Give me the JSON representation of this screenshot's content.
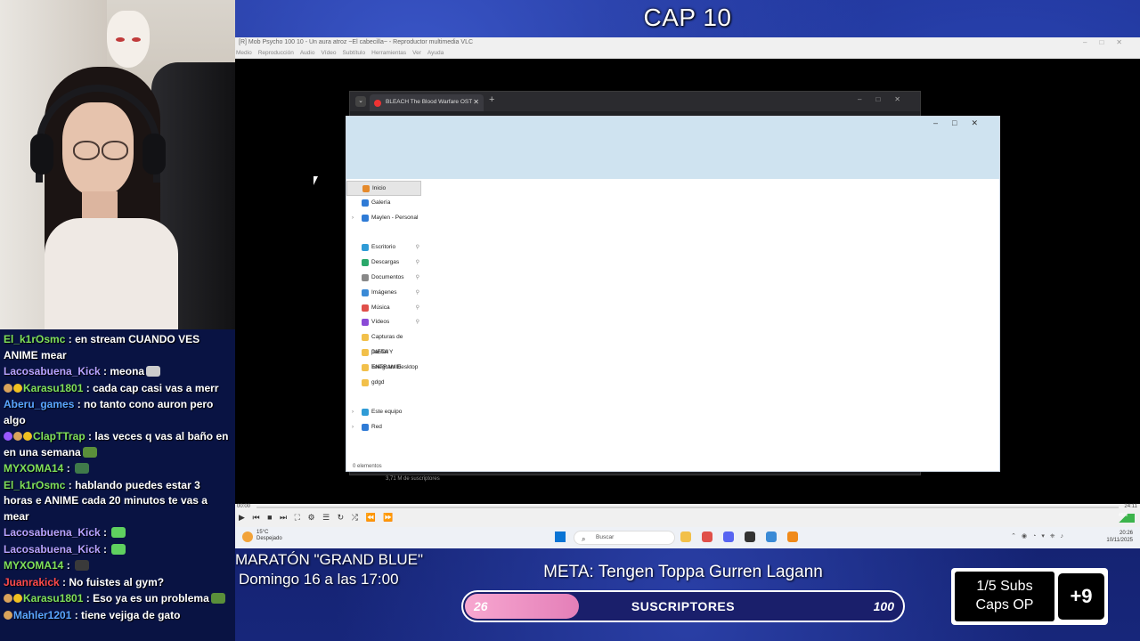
{
  "stream": {
    "episode_title": "CAP 10"
  },
  "chat": {
    "messages": [
      {
        "user": "El_k1rOsmc",
        "color": "#7fe05a",
        "badges": [],
        "text": "en stream CUANDO VES ANIME mear",
        "emote": null
      },
      {
        "user": "Lacosabuena_Kick",
        "color": "#b9a3ff",
        "badges": [],
        "text": "meona",
        "emote": "#cccccc"
      },
      {
        "user": "Karasu1801",
        "color": "#7fe05a",
        "badges": [
          "#d9a35b",
          "#f0c020"
        ],
        "text": "cada cap casi vas a merr",
        "emote": null
      },
      {
        "user": "Aberu_games",
        "color": "#5aa6ff",
        "badges": [],
        "text": "no tanto cono auron pero algo",
        "emote": null
      },
      {
        "user": "ClapTTrap",
        "color": "#7fe05a",
        "badges": [
          "#9b59ff",
          "#d9a35b",
          "#f0c020"
        ],
        "text": "las veces q vas al baño en en una semana",
        "emote": "#5a8f3a"
      },
      {
        "user": "MYXOMA14",
        "color": "#7fe05a",
        "badges": [],
        "text": "",
        "emote": "#3f7a4a"
      },
      {
        "user": "El_k1rOsmc",
        "color": "#7fe05a",
        "badges": [],
        "text": "hablando puedes estar 3 horas e ANIME cada 20 minutos te vas a mear",
        "emote": null
      },
      {
        "user": "Lacosabuena_Kick",
        "color": "#b9a3ff",
        "badges": [],
        "text": "",
        "emote": "#5fd05f"
      },
      {
        "user": "Lacosabuena_Kick",
        "color": "#b9a3ff",
        "badges": [],
        "text": "",
        "emote": "#5fd05f"
      },
      {
        "user": "MYXOMA14",
        "color": "#7fe05a",
        "badges": [],
        "text": "",
        "emote": "#3a3a3a"
      },
      {
        "user": "Juanrakick",
        "color": "#ff4a4a",
        "badges": [],
        "text": "No fuistes al gym?",
        "emote": null
      },
      {
        "user": "Karasu1801",
        "color": "#7fe05a",
        "badges": [
          "#d9a35b",
          "#f0c020"
        ],
        "text": "Eso ya es un problema",
        "emote": "#5a8f3a"
      },
      {
        "user": "Mahler1201",
        "color": "#5aa6ff",
        "badges": [
          "#d9a35b"
        ],
        "text": "tiene vejiga de gato",
        "emote": null
      }
    ]
  },
  "vlc": {
    "title": "[R] Mob Psycho 100 10 - Un aura atroz ~El cabecilla~ - Reproductor multimedia VLC",
    "menu": [
      "Medio",
      "Reproducción",
      "Audio",
      "Vídeo",
      "Subtítulo",
      "Herramientas",
      "Ver",
      "Ayuda"
    ],
    "time_elapsed": "00:00",
    "time_total": "24:11",
    "volume": "45%"
  },
  "browser": {
    "tab_title": "BLEACH The Blood Warfare OST",
    "channel_subs": "3,71 M de suscriptores"
  },
  "explorer": {
    "nav_top": [
      {
        "label": "Inicio",
        "icon": "home-icon",
        "color": "#e58a2c",
        "selected": true,
        "arrow": false
      },
      {
        "label": "Galería",
        "icon": "gallery-icon",
        "color": "#2f7bd6",
        "selected": false,
        "arrow": false
      },
      {
        "label": "Maylen - Personal",
        "icon": "onedrive-icon",
        "color": "#2f7bd6",
        "selected": false,
        "arrow": true
      }
    ],
    "nav_quick": [
      {
        "label": "Escritorio",
        "icon": "desktop-icon",
        "color": "#2f9bd6",
        "pin": true
      },
      {
        "label": "Descargas",
        "icon": "download-icon",
        "color": "#2aa86a",
        "pin": true
      },
      {
        "label": "Documentos",
        "icon": "document-icon",
        "color": "#888888",
        "pin": true
      },
      {
        "label": "Imágenes",
        "icon": "pictures-icon",
        "color": "#3a8ad6",
        "pin": true
      },
      {
        "label": "Música",
        "icon": "music-icon",
        "color": "#e0504a",
        "pin": true
      },
      {
        "label": "Vídeos",
        "icon": "videos-icon",
        "color": "#8a4ad6",
        "pin": true
      },
      {
        "label": "Capturas de pantall",
        "icon": "folder-icon",
        "color": "#f2c04a",
        "pin": false
      },
      {
        "label": "DIETA Y ENTRAMIE",
        "icon": "folder-icon",
        "color": "#f2c04a",
        "pin": false
      },
      {
        "label": "Telegram Desktop",
        "icon": "folder-icon",
        "color": "#f2c04a",
        "pin": false
      },
      {
        "label": "gdgd",
        "icon": "folder-icon",
        "color": "#f2c04a",
        "pin": false
      }
    ],
    "nav_bottom": [
      {
        "label": "Este equipo",
        "icon": "computer-icon",
        "color": "#2f9bd6"
      },
      {
        "label": "Red",
        "icon": "network-icon",
        "color": "#2f7bd6"
      }
    ],
    "status": "0 elementos"
  },
  "taskbar": {
    "weather_temp": "15°C",
    "weather_desc": "Despejado",
    "search_placeholder": "Buscar",
    "apps": [
      {
        "name": "explorer-app",
        "color": "#f2c04a"
      },
      {
        "name": "chrome-app",
        "color": "#e0504a"
      },
      {
        "name": "discord-app",
        "color": "#5865f2"
      },
      {
        "name": "obs-app",
        "color": "#333333"
      },
      {
        "name": "app-blue",
        "color": "#3a8ad6"
      },
      {
        "name": "vlc-app",
        "color": "#f08a1a"
      }
    ],
    "time": "20:26",
    "date": "10/11/2025"
  },
  "overlay": {
    "marathon_title": "MARATÓN \"GRAND BLUE\"",
    "marathon_time": "Domingo 16 a las 17:00",
    "meta": "META: Tengen Toppa Gurren Lagann",
    "goal_current": "26",
    "goal_label": "SUSCRIPTORES",
    "goal_max": "100",
    "goal_fraction": 0.26,
    "subs_line1": "1/5 Subs",
    "subs_line2": "Caps OP",
    "subs_plus": "+9"
  }
}
